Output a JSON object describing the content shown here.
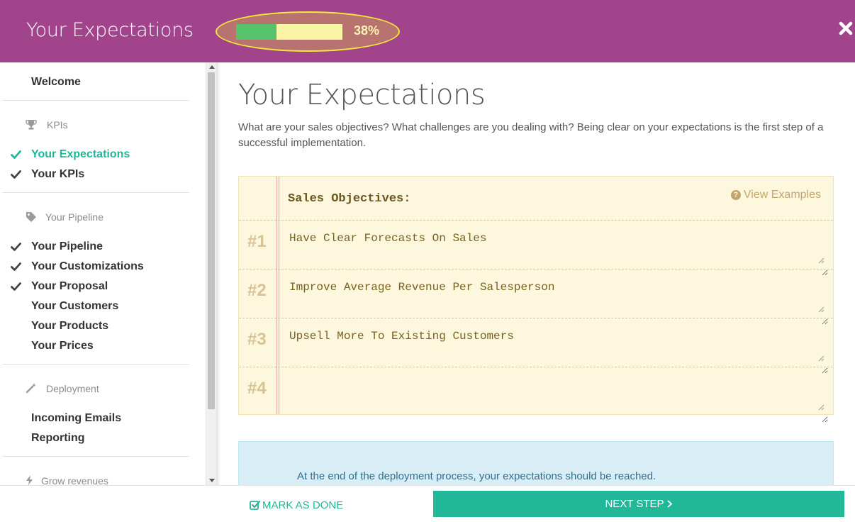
{
  "header": {
    "title": "Your Expectations",
    "progress": {
      "percent": 38,
      "label": "38%"
    },
    "close_icon": "close-icon"
  },
  "sidebar": {
    "welcome": "Welcome",
    "sections": [
      {
        "label": "KPIs",
        "icon": "trophy-icon"
      },
      {
        "label": "Your Pipeline",
        "icon": "tag-icon"
      },
      {
        "label": "Deployment",
        "icon": "magic-wand-icon"
      },
      {
        "label": "Grow revenues",
        "icon": "bolt-icon"
      }
    ],
    "items": [
      {
        "label": "Your Expectations",
        "checked": true,
        "active": true
      },
      {
        "label": "Your KPIs",
        "checked": true,
        "active": false
      },
      {
        "label": "Your Pipeline",
        "checked": true,
        "active": false
      },
      {
        "label": "Your Customizations",
        "checked": true,
        "active": false
      },
      {
        "label": "Your Proposal",
        "checked": true,
        "active": false
      },
      {
        "label": "Your Customers",
        "checked": false,
        "active": false
      },
      {
        "label": "Your Products",
        "checked": false,
        "active": false
      },
      {
        "label": "Your Prices",
        "checked": false,
        "active": false
      },
      {
        "label": "Incoming Emails",
        "checked": false,
        "active": false
      },
      {
        "label": "Reporting",
        "checked": false,
        "active": false
      }
    ]
  },
  "main": {
    "title": "Your Expectations",
    "description": "What are your sales objectives? What challenges are you dealing with? Being clear on your expectations is the first step of a successful implementation.",
    "notepad": {
      "heading": "Sales Objectives:",
      "view_examples": "View Examples",
      "rows": [
        {
          "number": "#1",
          "value": "Have Clear Forecasts On Sales"
        },
        {
          "number": "#2",
          "value": "Improve Average Revenue Per Salesperson"
        },
        {
          "number": "#3",
          "value": "Upsell More To Existing Customers"
        },
        {
          "number": "#4",
          "value": ""
        }
      ]
    },
    "info": "At the end of the deployment process, your expectations should be reached."
  },
  "footer": {
    "mark_done": "MARK AS DONE",
    "next_step": "NEXT STEP"
  },
  "colors": {
    "header_bg": "#a1448c",
    "accent": "#21b799",
    "progress_fill": "#56c36b",
    "progress_track": "#f9f4a6",
    "highlight_ring": "#f3e93a",
    "notepad_bg": "#fdf8dd",
    "info_bg": "#d9edf7"
  }
}
